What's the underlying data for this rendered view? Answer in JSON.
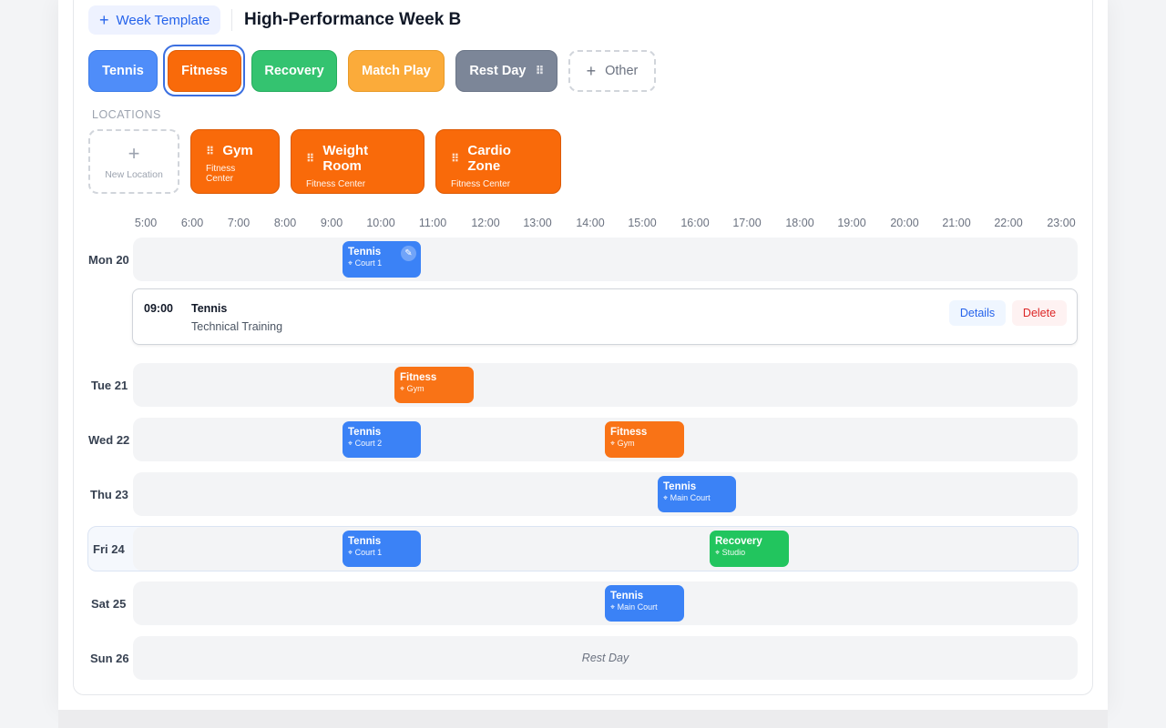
{
  "header": {
    "template_button": "Week Template",
    "title": "High-Performance Week B"
  },
  "types": [
    {
      "label": "Tennis"
    },
    {
      "label": "Fitness"
    },
    {
      "label": "Recovery"
    },
    {
      "label": "Match Play"
    },
    {
      "label": "Rest Day"
    },
    {
      "label": "Other"
    }
  ],
  "locations": {
    "heading": "LOCATIONS",
    "new_label": "New Location",
    "items": [
      {
        "name": "Gym",
        "group": "Fitness Center"
      },
      {
        "name": "Weight Room",
        "group": "Fitness Center"
      },
      {
        "name": "Cardio Zone",
        "group": "Fitness Center"
      }
    ]
  },
  "hours": [
    "5:00",
    "6:00",
    "7:00",
    "8:00",
    "9:00",
    "10:00",
    "11:00",
    "12:00",
    "13:00",
    "14:00",
    "15:00",
    "16:00",
    "17:00",
    "18:00",
    "19:00",
    "20:00",
    "21:00",
    "22:00",
    "23:00"
  ],
  "days": [
    {
      "label": "Mon 20"
    },
    {
      "label": "Tue 21"
    },
    {
      "label": "Wed 22"
    },
    {
      "label": "Thu 23"
    },
    {
      "label": "Fri 24"
    },
    {
      "label": "Sat 25"
    },
    {
      "label": "Sun 26",
      "rest_text": "Rest Day"
    }
  ],
  "events": [
    {
      "title": "Tennis",
      "location": "Court 1"
    },
    {
      "title": "Fitness",
      "location": "Gym"
    },
    {
      "title": "Tennis",
      "location": "Court 2"
    },
    {
      "title": "Fitness",
      "location": "Gym"
    },
    {
      "title": "Tennis",
      "location": "Main Court"
    },
    {
      "title": "Tennis",
      "location": "Court 1"
    },
    {
      "title": "Recovery",
      "location": "Studio"
    },
    {
      "title": "Tennis",
      "location": "Main Court"
    }
  ],
  "detail": {
    "time": "09:00",
    "type": "Tennis",
    "description": "Technical Training",
    "details_button": "Details",
    "delete_button": "Delete"
  },
  "colors": {
    "tennis": "#3b82f6",
    "fitness": "#f97316",
    "recovery": "#22c55e",
    "match_play": "#fbab3a",
    "rest_day": "#7c8698",
    "accent": "#2563eb",
    "danger": "#dc2626"
  }
}
